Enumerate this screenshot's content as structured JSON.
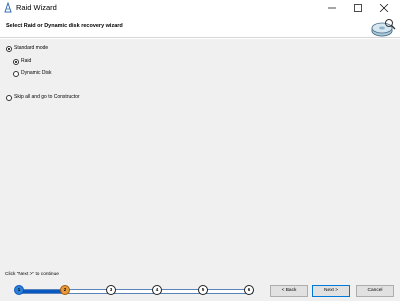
{
  "window": {
    "title": "Raid Wizard"
  },
  "header": {
    "title": "Select Raid or Dynamic disk recovery wizard"
  },
  "options": {
    "standard_mode": "Standard mode",
    "raid": "Raid",
    "dynamic_disk": "Dynamic Disk",
    "skip": "Skip all and go to Constructor"
  },
  "status": "Click \"Next >\" to continue",
  "wizard": {
    "steps": [
      "1",
      "2",
      "3",
      "4",
      "5",
      "6"
    ],
    "current_step": 2,
    "progress": 0.2
  },
  "buttons": {
    "back": "< Back",
    "next": "Next >",
    "cancel": "Cancel"
  },
  "colors": {
    "progress_fill": "#0a58c2",
    "current_step": "#e89a3a",
    "main_bg": "#f0f0f0"
  }
}
